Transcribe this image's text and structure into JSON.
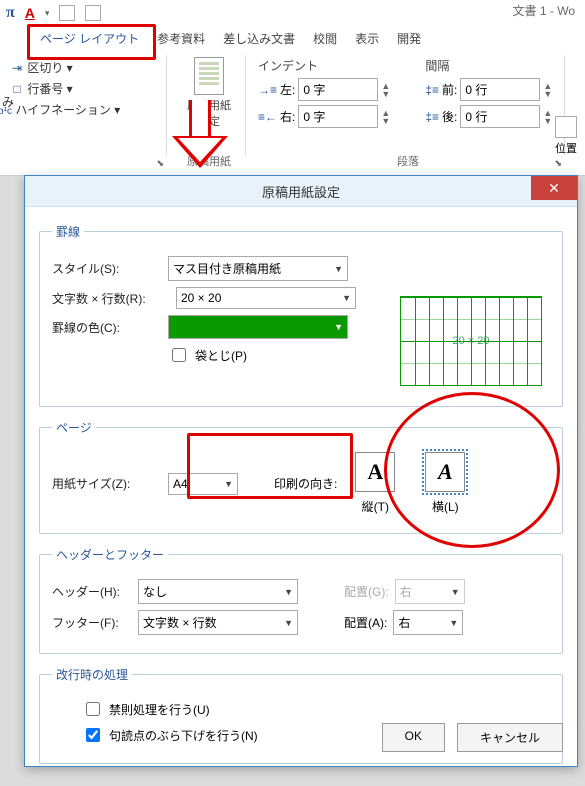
{
  "app": {
    "title": "文書 1 - Wo"
  },
  "tabs": {
    "layout": "ページ レイアウト",
    "reference": "参考資料",
    "mailings": "差し込み文書",
    "review": "校閲",
    "view": "表示",
    "dev": "開発"
  },
  "ribbon": {
    "left": {
      "mi": "み",
      "breaks": "区切り ▾",
      "lineNumbers": "行番号 ▾",
      "hyphen_prefix": "b¹c",
      "hyphen": "ハイフネーション ▾",
      "launcher": "⬊"
    },
    "genkou": {
      "setting": "原稿用紙",
      "setting2": "設定",
      "group": "原稿用紙"
    },
    "indent": {
      "header": "インデント",
      "left_label": "左:",
      "right_label": "右:",
      "left_val": "0 字",
      "right_val": "0 字"
    },
    "spacing": {
      "header": "間隔",
      "before_label": "前:",
      "after_label": "後:",
      "before_val": "0 行",
      "after_val": "0 行"
    },
    "paragraphGroup": "段落",
    "position": "位置"
  },
  "dialog": {
    "title": "原稿用紙設定",
    "close": "✕",
    "grid": {
      "legend": "罫線",
      "style_label": "スタイル(S):",
      "style_val": "マス目付き原稿用紙",
      "rc_label": "文字数 × 行数(R):",
      "rc_val": "20 × 20",
      "color_label": "罫線の色(C):",
      "bind_label": "袋とじ(P)",
      "preview_text": "20 × 20"
    },
    "page": {
      "legend": "ページ",
      "size_label": "用紙サイズ(Z):",
      "size_val": "A4",
      "orient_label": "印刷の向き:",
      "portrait": "縦(T)",
      "landscape": "横(L)"
    },
    "hf": {
      "legend": "ヘッダーとフッター",
      "header_label": "ヘッダー(H):",
      "header_val": "なし",
      "footer_label": "フッター(F):",
      "footer_val": "文字数 × 行数",
      "alignG_label": "配置(G):",
      "alignA_label": "配置(A):",
      "align_val": "右"
    },
    "linebreak": {
      "legend": "改行時の処理",
      "kinsoku": "禁則処理を行う(U)",
      "burasage": "句読点のぶら下げを行う(N)"
    },
    "buttons": {
      "ok": "OK",
      "cancel": "キャンセル"
    }
  }
}
